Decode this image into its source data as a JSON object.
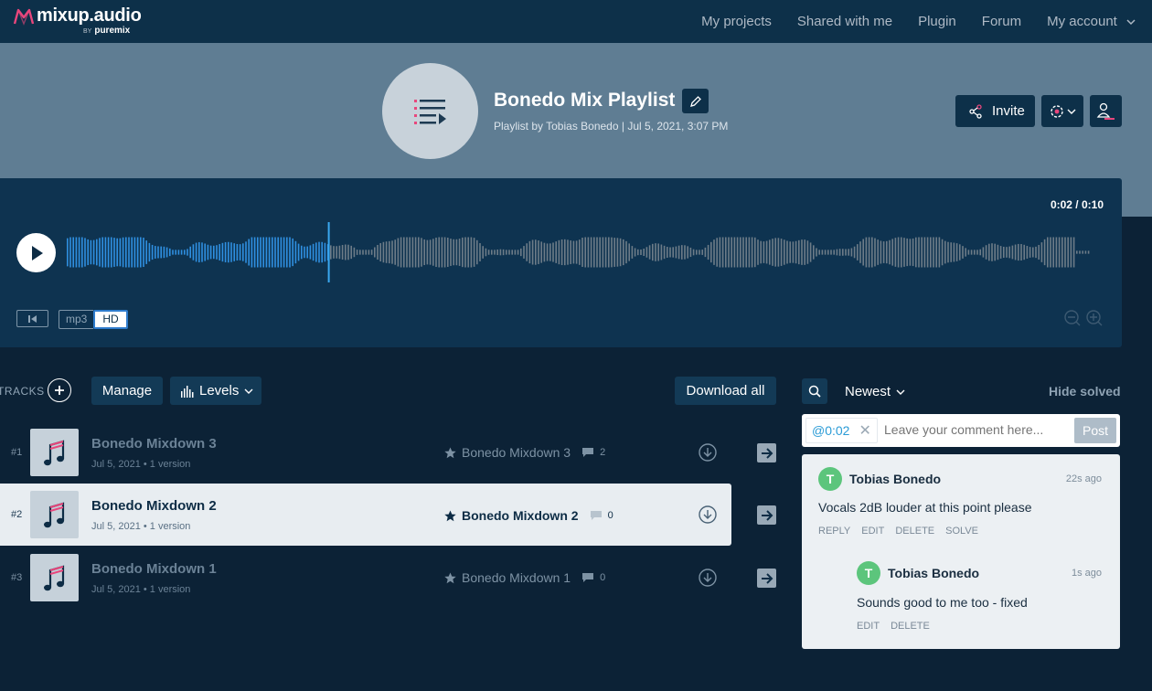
{
  "app": {
    "logo_name": "mixup.audio",
    "logo_by": "BY",
    "logo_brand": "puremix"
  },
  "nav": {
    "items": [
      {
        "label": "My projects"
      },
      {
        "label": "Shared with me"
      },
      {
        "label": "Plugin"
      },
      {
        "label": "Forum"
      },
      {
        "label": "My account"
      }
    ]
  },
  "playlist": {
    "title": "Bonedo Mix Playlist",
    "subtitle": "Playlist by Tobias Bonedo  |  Jul 5, 2021, 3:07 PM",
    "invite_label": "Invite"
  },
  "player": {
    "time": "0:02 / 0:10",
    "progress": 0.255,
    "format_mp3": "mp3",
    "format_hd": "HD",
    "active_format": "HD"
  },
  "tracks_toolbar": {
    "label": "TRACKS",
    "manage_label": "Manage",
    "levels_label": "Levels",
    "download_all_label": "Download all"
  },
  "tracks": [
    {
      "num": "#1",
      "name": "Bonedo Mixdown 3",
      "meta": "Jul 5, 2021 • 1 version",
      "version_name": "Bonedo Mixdown 3",
      "comments": "2",
      "active": false
    },
    {
      "num": "#2",
      "name": "Bonedo Mixdown 2",
      "meta": "Jul 5, 2021 • 1 version",
      "version_name": "Bonedo Mixdown 2",
      "comments": "0",
      "active": true
    },
    {
      "num": "#3",
      "name": "Bonedo Mixdown 1",
      "meta": "Jul 5, 2021 • 1 version",
      "version_name": "Bonedo Mixdown 1",
      "comments": "0",
      "active": false
    }
  ],
  "comments_panel": {
    "sort_label": "Newest",
    "hide_solved_label": "Hide solved",
    "timestamp_chip": "@0:02",
    "input_placeholder": "Leave your comment here...",
    "post_label": "Post"
  },
  "comments": [
    {
      "avatar": "T",
      "author": "Tobias Bonedo",
      "time": "22s ago",
      "text": "Vocals 2dB louder at this point please",
      "actions": [
        "REPLY",
        "EDIT",
        "DELETE",
        "SOLVE"
      ]
    },
    {
      "avatar": "T",
      "author": "Tobias Bonedo",
      "time": "1s ago",
      "text": "Sounds good to me too - fixed",
      "actions": [
        "EDIT",
        "DELETE"
      ]
    }
  ],
  "colors": {
    "nav_bg": "#0d3049",
    "hero_bg": "#5f7d93",
    "player_bg": "#0e3350",
    "wave_played": "#2f8fe0",
    "wave_unplayed": "#6d7c88",
    "playhead": "#3aa8f0",
    "brand_pink": "#e8467c",
    "avatar_green": "#5cc57c"
  }
}
